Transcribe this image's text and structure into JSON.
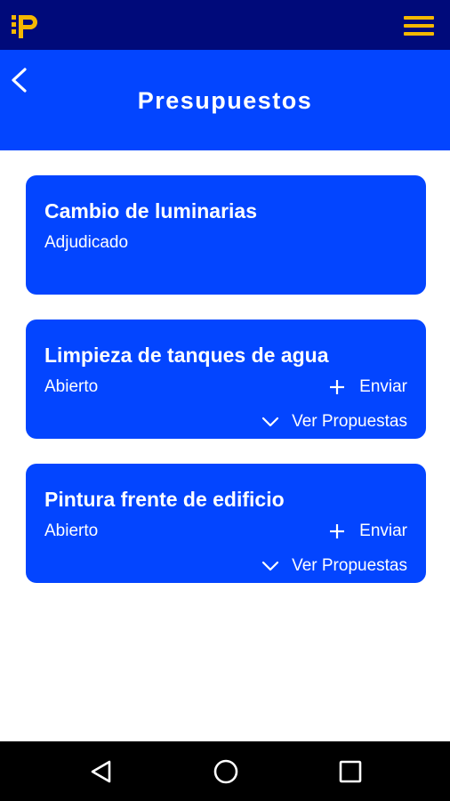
{
  "app": {
    "logo_icon": "app-logo-ip-icon",
    "menu_icon": "hamburger-menu-icon"
  },
  "header": {
    "back_icon": "chevron-left-icon",
    "title": "Presupuestos"
  },
  "budgets": [
    {
      "title": "Cambio de luminarias",
      "status": "Adjudicado"
    },
    {
      "title": "Limpieza de tanques de agua",
      "status": "Abierto",
      "send_label": "Enviar",
      "proposals_label": "Ver Propuestas"
    },
    {
      "title": "Pintura frente de edificio",
      "status": "Abierto",
      "send_label": "Enviar",
      "proposals_label": "Ver Propuestas"
    }
  ],
  "colors": {
    "topbar": "#000a7a",
    "primary": "#0345ff",
    "accent_gold": "#f5b800",
    "navbar": "#000000"
  },
  "system_nav": {
    "back_icon": "triangle-back-icon",
    "home_icon": "circle-home-icon",
    "recents_icon": "square-recents-icon"
  }
}
